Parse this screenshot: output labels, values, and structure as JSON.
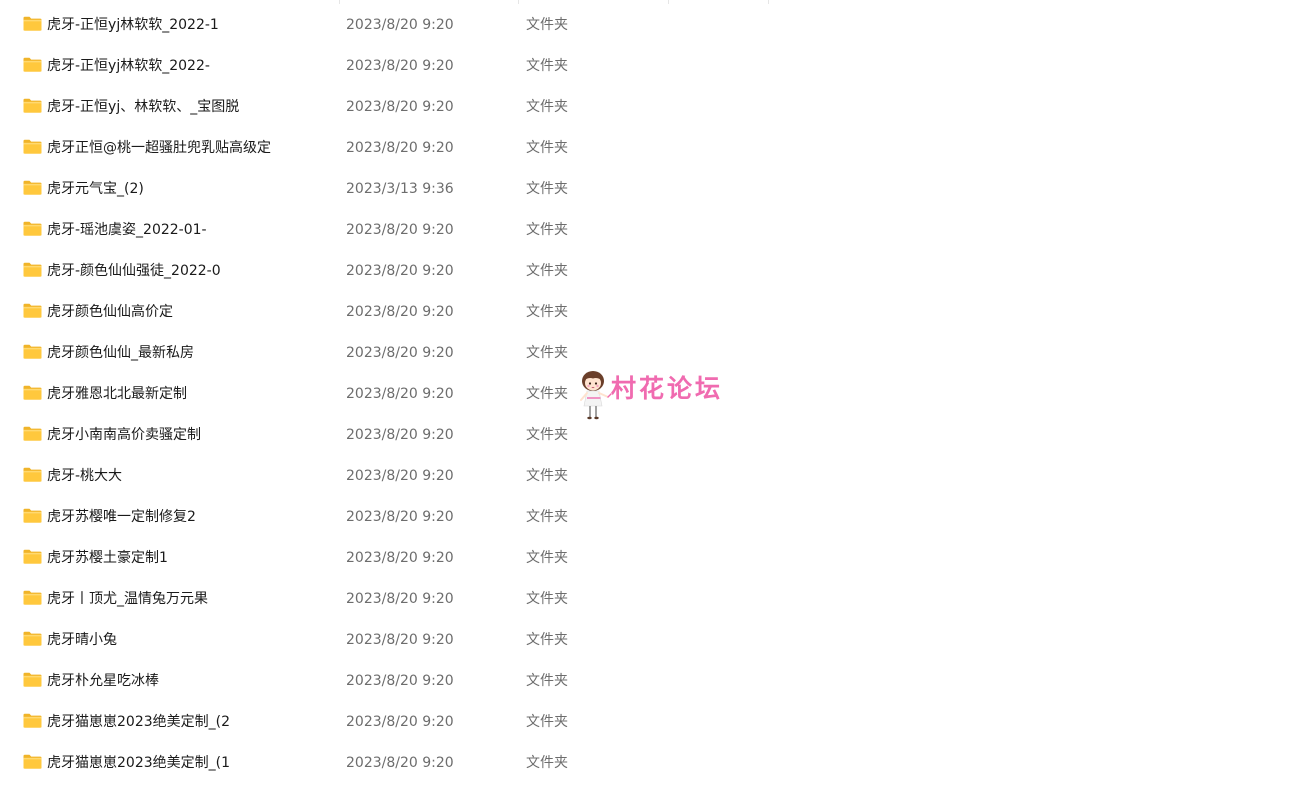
{
  "files": [
    {
      "name": "虎牙-正恒yj林软软_2022-1",
      "date": "2023/8/20 9:20",
      "type": "文件夹",
      "icon": "folder-icon"
    },
    {
      "name": "虎牙-正恒yj林软软_2022-",
      "date": "2023/8/20 9:20",
      "type": "文件夹",
      "icon": "folder-icon"
    },
    {
      "name": "虎牙-正恒yj、林软软、_宝图脱",
      "date": "2023/8/20 9:20",
      "type": "文件夹",
      "icon": "folder-icon"
    },
    {
      "name": "虎牙正恒@桃一超骚肚兜乳贴高级定",
      "date": "2023/8/20 9:20",
      "type": "文件夹",
      "icon": "folder-icon"
    },
    {
      "name": "虎牙元气宝_(2)",
      "date": "2023/3/13 9:36",
      "type": "文件夹",
      "icon": "folder-icon"
    },
    {
      "name": "虎牙-瑶池虞姿_2022-01-",
      "date": "2023/8/20 9:20",
      "type": "文件夹",
      "icon": "folder-icon"
    },
    {
      "name": "虎牙-颜色仙仙强徒_2022-0",
      "date": "2023/8/20 9:20",
      "type": "文件夹",
      "icon": "folder-icon"
    },
    {
      "name": "虎牙颜色仙仙高价定",
      "date": "2023/8/20 9:20",
      "type": "文件夹",
      "icon": "folder-icon"
    },
    {
      "name": "虎牙颜色仙仙_最新私房",
      "date": "2023/8/20 9:20",
      "type": "文件夹",
      "icon": "folder-icon"
    },
    {
      "name": "虎牙雅恩北北最新定制",
      "date": "2023/8/20 9:20",
      "type": "文件夹",
      "icon": "folder-icon"
    },
    {
      "name": "虎牙小南南高价卖骚定制",
      "date": "2023/8/20 9:20",
      "type": "文件夹",
      "icon": "folder-icon"
    },
    {
      "name": "虎牙-桃大大",
      "date": "2023/8/20 9:20",
      "type": "文件夹",
      "icon": "folder-icon"
    },
    {
      "name": "虎牙苏樱唯一定制修复2",
      "date": "2023/8/20 9:20",
      "type": "文件夹",
      "icon": "folder-icon"
    },
    {
      "name": "虎牙苏樱土豪定制1",
      "date": "2023/8/20 9:20",
      "type": "文件夹",
      "icon": "folder-icon"
    },
    {
      "name": "虎牙丨顶尤_温情兔万元果",
      "date": "2023/8/20 9:20",
      "type": "文件夹",
      "icon": "folder-icon"
    },
    {
      "name": "虎牙晴小兔",
      "date": "2023/8/20 9:20",
      "type": "文件夹",
      "icon": "folder-icon"
    },
    {
      "name": "虎牙朴允星吃冰棒",
      "date": "2023/8/20 9:20",
      "type": "文件夹",
      "icon": "folder-icon"
    },
    {
      "name": "虎牙猫崽崽2023绝美定制_(2",
      "date": "2023/8/20 9:20",
      "type": "文件夹",
      "icon": "folder-icon"
    },
    {
      "name": "虎牙猫崽崽2023绝美定制_(1",
      "date": "2023/8/20 9:20",
      "type": "文件夹",
      "icon": "folder-icon"
    }
  ],
  "watermark": {
    "text": "村花论坛",
    "icon": "girl-mascot-icon",
    "color": "#f06bb0"
  },
  "colors": {
    "folder_fill": "#ffc83d",
    "folder_tab": "#f0b429",
    "name_text": "#1a1a1a",
    "meta_text": "#6d6d6d"
  }
}
